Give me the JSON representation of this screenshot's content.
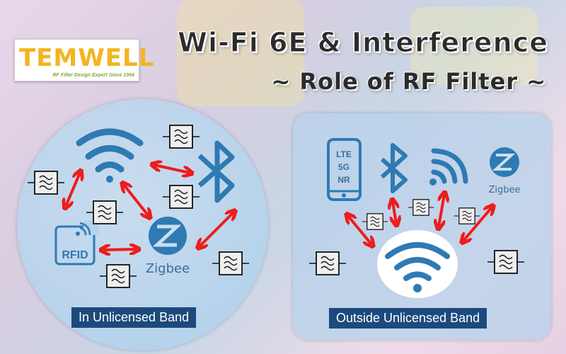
{
  "logo": {
    "name": "TEMWELL",
    "tagline": "RF Filter Design Expert Since 1994",
    "color": "#f2b51e"
  },
  "header": {
    "title": "Wi-Fi 6E & Interference",
    "subtitle": "~ Role of RF Filter ~"
  },
  "left_panel": {
    "label": "In Unlicensed Band",
    "icons": [
      "wifi-icon",
      "bluetooth-icon",
      "rfid-icon",
      "zigbee-icon"
    ],
    "rfid_text": "RFID",
    "zigbee_text": "Zigbee"
  },
  "right_panel": {
    "label": "Outside Unlicensed Band",
    "icons": [
      "phone-icon",
      "bluetooth-icon",
      "wifi-icon",
      "zigbee-icon",
      "wifi-6e-icon"
    ],
    "phone_lines": [
      "LTE",
      "5G",
      "NR"
    ],
    "zigbee_text": "Zigbee"
  },
  "colors": {
    "icon_blue": "#2f7ab3",
    "arrow_red": "#ee1c1c",
    "label_bg": "#1d4a7c"
  }
}
